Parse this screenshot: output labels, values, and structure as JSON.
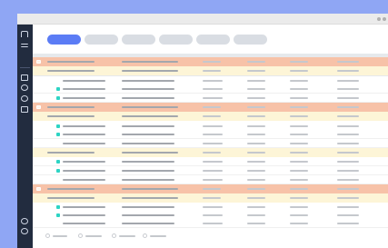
{
  "app": {
    "title": "",
    "accent_color": "#5b7cf5",
    "sidebar_color": "#222c3f",
    "group_colors": [
      "#f7c2a8",
      "#fdf5d7"
    ],
    "status_color": "#2dd4c4"
  },
  "window": {
    "controls": [
      "minimize",
      "close"
    ]
  },
  "sidebar": {
    "items": [
      {
        "icon": "logo-icon"
      },
      {
        "icon": "menu-icon"
      },
      {
        "icon": "document-icon"
      },
      {
        "icon": "clock-icon"
      },
      {
        "icon": "refresh-icon"
      },
      {
        "icon": "file-icon"
      },
      {
        "icon": "sync-icon"
      },
      {
        "icon": "settings-icon"
      }
    ]
  },
  "tabs": [
    {
      "label": "",
      "active": true
    },
    {
      "label": "",
      "active": false
    },
    {
      "label": "",
      "active": false
    },
    {
      "label": "",
      "active": false
    },
    {
      "label": "",
      "active": false
    },
    {
      "label": "",
      "active": false
    }
  ],
  "table": {
    "columns": [
      "",
      "",
      "",
      "",
      "",
      ""
    ],
    "filters": [
      "",
      "",
      "",
      "",
      "",
      ""
    ],
    "rows": [
      {
        "type": "group",
        "tone": "orange"
      },
      {
        "type": "group",
        "tone": "yellow"
      },
      {
        "type": "item",
        "status": false
      },
      {
        "type": "item",
        "status": true
      },
      {
        "type": "item",
        "status": true
      },
      {
        "type": "group",
        "tone": "orange"
      },
      {
        "type": "group",
        "tone": "yellow"
      },
      {
        "type": "item",
        "status": true
      },
      {
        "type": "item",
        "status": true
      },
      {
        "type": "item",
        "status": false
      },
      {
        "type": "group",
        "tone": "yellow"
      },
      {
        "type": "item",
        "status": true
      },
      {
        "type": "item",
        "status": true
      },
      {
        "type": "item",
        "status": false
      },
      {
        "type": "group",
        "tone": "orange"
      },
      {
        "type": "group",
        "tone": "yellow"
      },
      {
        "type": "item",
        "status": true
      },
      {
        "type": "item",
        "status": true
      },
      {
        "type": "item",
        "status": false
      }
    ]
  },
  "pagination": {
    "pages": [
      "",
      "",
      "",
      ""
    ]
  }
}
